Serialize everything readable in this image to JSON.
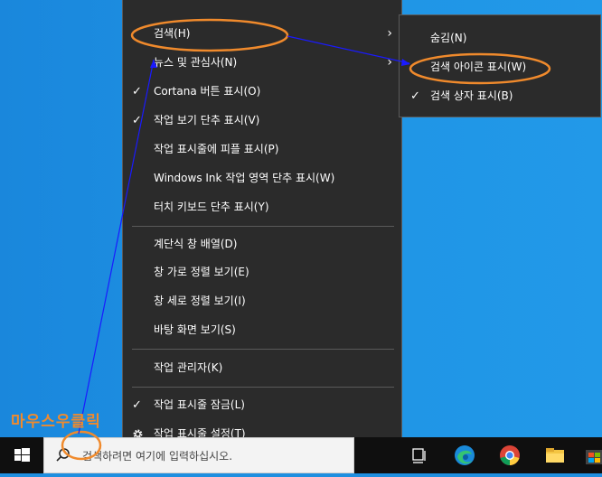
{
  "menu": {
    "items": [
      {
        "label": "검색(H)",
        "check": false,
        "arrow": true
      },
      {
        "label": "뉴스 및 관심사(N)",
        "check": false,
        "arrow": true
      },
      {
        "label": "Cortana 버튼 표시(O)",
        "check": true,
        "arrow": false
      },
      {
        "label": "작업 보기 단추 표시(V)",
        "check": true,
        "arrow": false
      },
      {
        "label": "작업 표시줄에 피플 표시(P)",
        "check": false,
        "arrow": false
      },
      {
        "label": "Windows Ink 작업 영역 단추 표시(W)",
        "check": false,
        "arrow": false
      },
      {
        "label": "터치 키보드 단추 표시(Y)",
        "check": false,
        "arrow": false
      },
      {
        "label": "계단식 창 배열(D)",
        "check": false,
        "arrow": false
      },
      {
        "label": "창 가로 정렬 보기(E)",
        "check": false,
        "arrow": false
      },
      {
        "label": "창 세로 정렬 보기(I)",
        "check": false,
        "arrow": false
      },
      {
        "label": "바탕 화면 보기(S)",
        "check": false,
        "arrow": false
      },
      {
        "label": "작업 관리자(K)",
        "check": false,
        "arrow": false
      },
      {
        "label": "작업 표시줄 잠금(L)",
        "check": true,
        "arrow": false
      },
      {
        "label": "작업 표시줄 설정(T)",
        "check": false,
        "arrow": false,
        "icon": "gear-icon"
      }
    ]
  },
  "submenu": {
    "items": [
      {
        "label": "숨김(N)",
        "check": false
      },
      {
        "label": "검색 아이콘 표시(W)",
        "check": false
      },
      {
        "label": "검색 상자 표시(B)",
        "check": true
      }
    ]
  },
  "taskbar": {
    "search_placeholder": "검색하려면 여기에 입력하십시오.",
    "icons": [
      "windows-start-icon",
      "task-view-icon",
      "edge-icon",
      "chrome-icon",
      "file-explorer-icon",
      "store-icon"
    ]
  },
  "annotation": {
    "label": "마우스우클릭",
    "color": "#f08a2c",
    "line_color": "#1a1aff"
  }
}
